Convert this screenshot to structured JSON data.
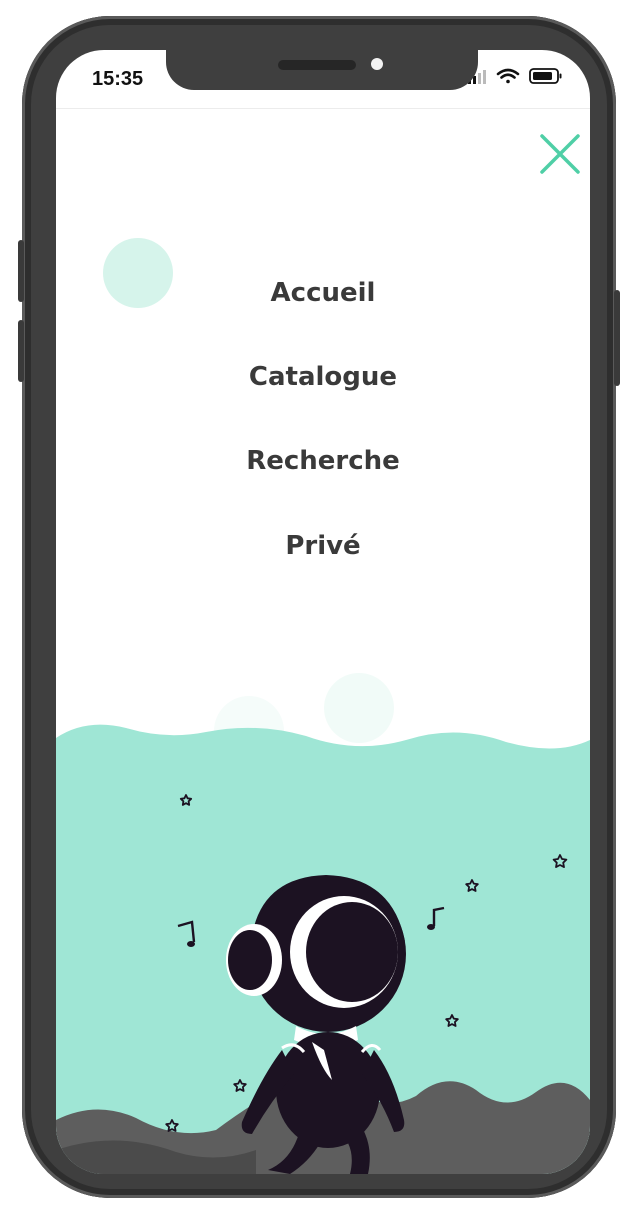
{
  "status_bar": {
    "time": "15:35",
    "icons": [
      "signal-icon",
      "wifi-icon",
      "battery-icon"
    ]
  },
  "menu": {
    "close_icon": "close-icon",
    "items": [
      {
        "label": "Accueil"
      },
      {
        "label": "Catalogue"
      },
      {
        "label": "Recherche"
      },
      {
        "label": "Privé"
      }
    ]
  },
  "colors": {
    "accent": "#4fcfa6",
    "wave": "#9fe6d5",
    "bubble": "#d6f4eb",
    "menu_text": "#3a3a3a",
    "astronaut": "#1c1222",
    "phone_frame": "#3f3f3f"
  }
}
